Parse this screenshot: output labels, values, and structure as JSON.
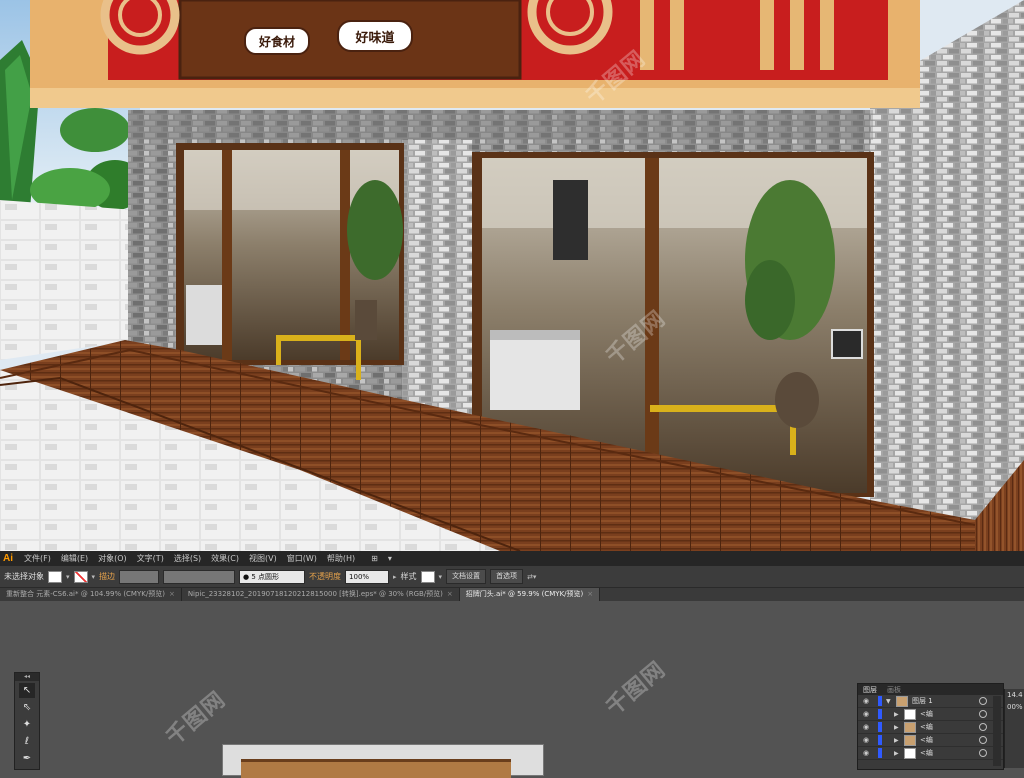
{
  "sign": {
    "badge_left": "好食材",
    "badge_right": "好味道"
  },
  "watermark": "千图网",
  "app": {
    "logo": "Ai",
    "menu": [
      "文件(F)",
      "编辑(E)",
      "对象(O)",
      "文字(T)",
      "选择(S)",
      "效果(C)",
      "视图(V)",
      "窗口(W)",
      "帮助(H)"
    ],
    "workspace_icon": "⊞",
    "workspace_menu": "▾"
  },
  "control_bar": {
    "selection_status": "未选择对象",
    "stroke_label": "描边",
    "brush_label": "5 点圆形",
    "opacity_label": "不透明度",
    "opacity_value": "100%",
    "style_label": "样式",
    "doc_setup": "文档设置",
    "preferences": "首选项"
  },
  "document_tabs": [
    {
      "title": "重新整合 元素-CS6.ai* @ 104.99% (CMYK/预览)",
      "close": "×",
      "active": false
    },
    {
      "title": "Nipic_23328102_20190718120212815000 [转换].eps* @ 30% (RGB/预览)",
      "close": "×",
      "active": false
    },
    {
      "title": "招牌门头.ai* @ 59.9% (CMYK/预览)",
      "close": "×",
      "active": true
    }
  ],
  "toolbox": {
    "grip": "◂◂",
    "tools": [
      {
        "name": "selection-tool",
        "glyph": "↖"
      },
      {
        "name": "direct-selection-tool",
        "glyph": "⇖"
      },
      {
        "name": "magic-wand-tool",
        "glyph": "✦"
      },
      {
        "name": "lasso-tool",
        "glyph": "ℓ"
      },
      {
        "name": "pen-tool",
        "glyph": "✒"
      }
    ]
  },
  "layers_panel": {
    "tab_layers": "图层",
    "tab_artboards": "画板",
    "layer_name": "图层 1",
    "rows": [
      "<编",
      "<编",
      "<编",
      "<编"
    ]
  },
  "side_panel": {
    "value1": "14.4",
    "value2": "00%"
  }
}
